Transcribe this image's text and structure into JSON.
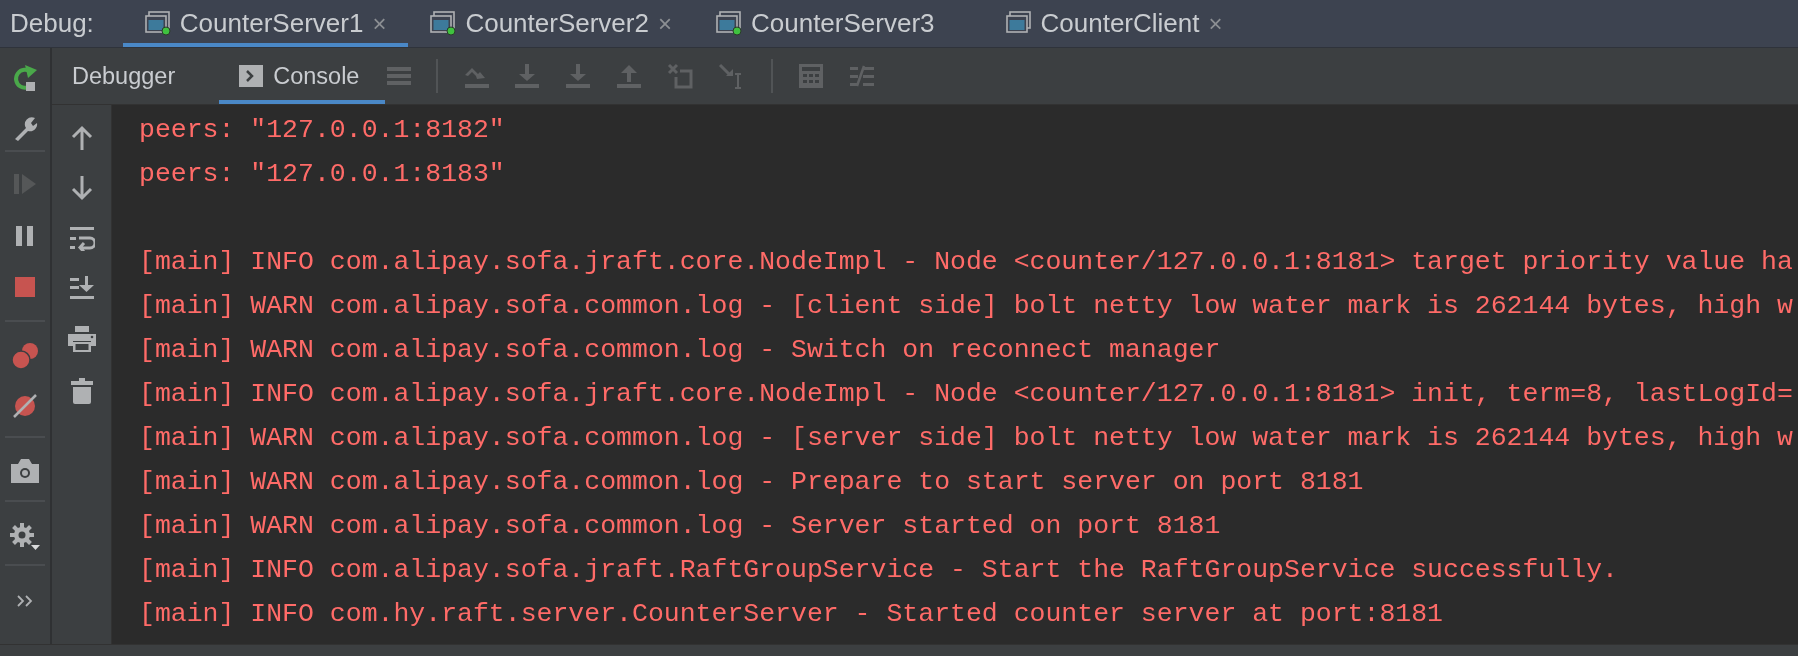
{
  "debug_label": "Debug:",
  "tabs": [
    {
      "label": "CounterServer1",
      "selected": true,
      "running": true,
      "close": "×"
    },
    {
      "label": "CounterServer2",
      "selected": false,
      "running": true,
      "close": "×"
    },
    {
      "label": "CounterServer3",
      "selected": false,
      "running": true
    },
    {
      "label": "CounterClient",
      "selected": false,
      "running": false,
      "close": "×"
    }
  ],
  "inner_tabs": [
    {
      "label": "Debugger",
      "selected": false,
      "kind": "text"
    },
    {
      "label": "Console",
      "selected": true,
      "kind": "console"
    }
  ],
  "console": {
    "groups": [
      [
        "peers: \"127.0.0.1:8182\"",
        "peers: \"127.0.0.1:8183\""
      ],
      [
        "[main] INFO com.alipay.sofa.jraft.core.NodeImpl - Node <counter/127.0.0.1:8181> target priority value ha",
        "[main] WARN com.alipay.sofa.common.log - [client side] bolt netty low water mark is 262144 bytes, high w",
        "[main] WARN com.alipay.sofa.common.log - Switch on reconnect manager",
        "[main] INFO com.alipay.sofa.jraft.core.NodeImpl - Node <counter/127.0.0.1:8181> init, term=8, lastLogId=",
        "[main] WARN com.alipay.sofa.common.log - [server side] bolt netty low water mark is 262144 bytes, high w",
        "[main] WARN com.alipay.sofa.common.log - Prepare to start server on port 8181",
        "[main] WARN com.alipay.sofa.common.log - Server started on port 8181",
        "[main] INFO com.alipay.sofa.jraft.RaftGroupService - Start the RaftGroupService successfully.",
        "[main] INFO com.hy.raft.server.CounterServer - Started counter server at port:8181"
      ]
    ]
  }
}
